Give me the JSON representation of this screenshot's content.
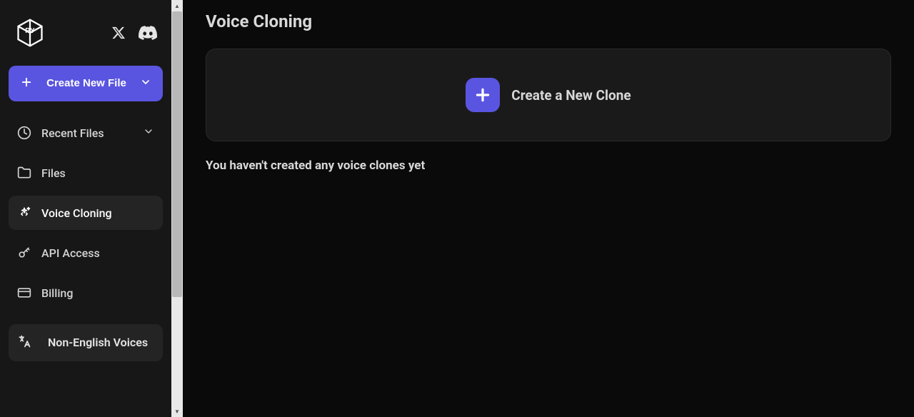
{
  "sidebar": {
    "create_button": {
      "label": "Create New File"
    },
    "items": [
      {
        "label": "Recent Files",
        "icon": "clock-icon",
        "has_chevron": true,
        "active": false
      },
      {
        "label": "Files",
        "icon": "folder-icon",
        "has_chevron": false,
        "active": false
      },
      {
        "label": "Voice Cloning",
        "icon": "sparkles-icon",
        "has_chevron": false,
        "active": true
      },
      {
        "label": "API Access",
        "icon": "key-icon",
        "has_chevron": false,
        "active": false
      },
      {
        "label": "Billing",
        "icon": "credit-card-icon",
        "has_chevron": false,
        "active": false
      }
    ],
    "non_english": {
      "label": "Non-English Voices"
    }
  },
  "main": {
    "title": "Voice Cloning",
    "create_clone_label": "Create a New Clone",
    "empty_message": "You haven't created any voice clones yet"
  }
}
